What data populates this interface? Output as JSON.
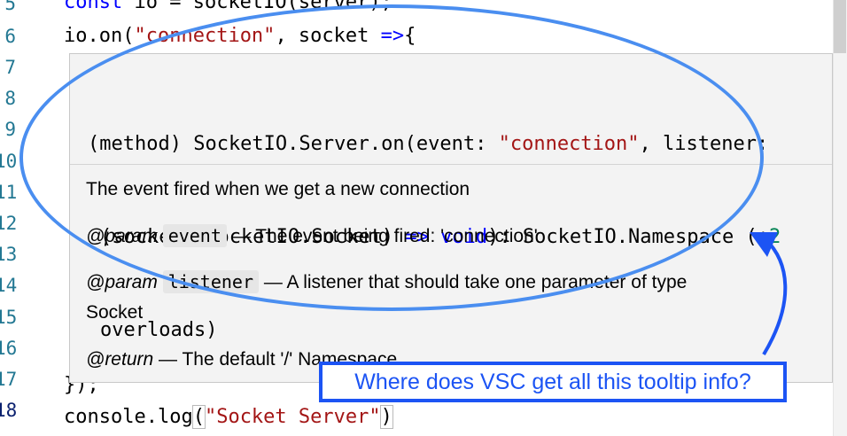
{
  "editor": {
    "line_numbers": [
      "5",
      "6",
      "7",
      "8",
      "9",
      "10",
      "11",
      "12",
      "13",
      "14",
      "15",
      "16",
      "17",
      "18"
    ],
    "active_line": "18",
    "line5": {
      "prefix_kw": "const",
      "text": " io = socketIO(server);"
    },
    "line6": {
      "pre": "io.on(",
      "str": "\"connection\"",
      "post": ", socket ",
      "arrow": "=>",
      "end": "{"
    },
    "line17": "});",
    "line18": {
      "pre": "console.log",
      "open": "(",
      "str": "\"Socket Server\"",
      "close": ")"
    }
  },
  "hover": {
    "sig_part1": "(method) SocketIO.Server.on(event: ",
    "sig_str": "\"connection\"",
    "sig_part2": ", listener:",
    "sig_line2_a": "(socket: SocketIO.Socket) ",
    "sig_line2_arrow": "=>",
    "sig_line2_void": "void",
    "sig_line2_b": "): SocketIO.Namespace (+",
    "sig_line2_num": "2",
    "sig_line3": "overloads)",
    "description": "The event fired when we get a new connection",
    "param_tag": "@param",
    "param1_name": "event",
    "param1_desc": " — The event being fired: 'connection'",
    "param2_name": "listener",
    "param2_desc": " — A listener that should take one parameter of type",
    "param2_desc_cont": "Socket",
    "return_tag": "@return",
    "return_desc": " — The default '/' Namespace"
  },
  "annotation": {
    "callout_text": "Where does VSC get all this tooltip info?",
    "ellipse_color": "#4a8ef0",
    "callout_color": "#1c54f4"
  }
}
